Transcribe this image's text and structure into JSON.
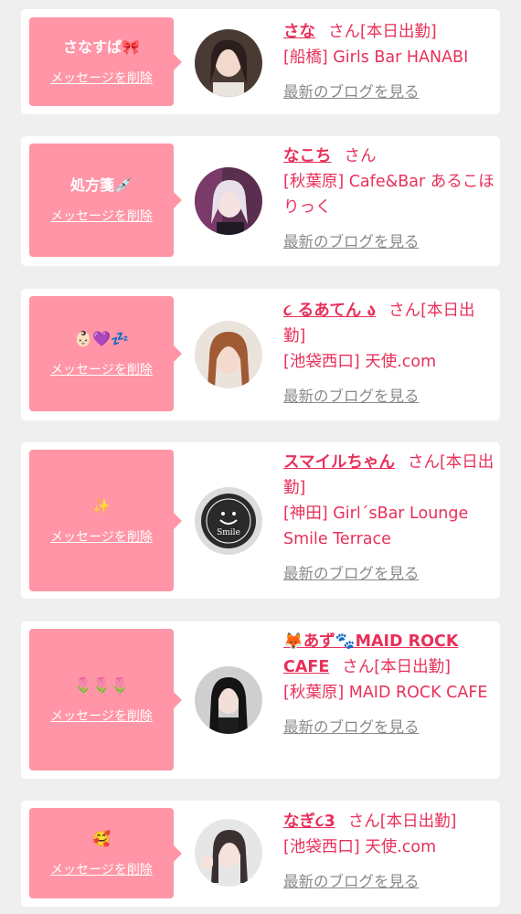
{
  "delete_label": "メッセージを削除",
  "blog_label": "最新のブログを見る",
  "san_label": "さん",
  "cards": [
    {
      "message": "さなすぱ🎀",
      "name": "さな",
      "san_suffix": "さん[本日出勤]",
      "shop": "[船橋] Girls Bar HANABI"
    },
    {
      "message": "処方箋💉",
      "name": "なこち",
      "san_suffix": "さん",
      "shop": "[秋葉原] Cafe&Bar あるこほりっく"
    },
    {
      "message": "👶🏻💜💤",
      "name": "૮ るあてん ა",
      "san_suffix": "さん[本日出勤]",
      "shop": "[池袋西口] 天使.com"
    },
    {
      "message": "✨",
      "name": "スマイルちゃん",
      "san_suffix": "さん[本日出勤]",
      "shop": "[神田] Girl´sBar Lounge Smile Terrace"
    },
    {
      "message": "🌷🌷🌷",
      "name": "🦊あず🐾MAID ROCK CAFE",
      "san_suffix": "さん[本日出勤]",
      "shop": "[秋葉原] MAID ROCK CAFE"
    },
    {
      "message": "🥰",
      "name": "なぎ૮3",
      "san_suffix": "さん[本日出勤]",
      "shop": "[池袋西口] 天使.com"
    }
  ],
  "colors": {
    "accent": "#e8305a",
    "bubble": "#ff95a6",
    "background": "#efefef",
    "muted": "#8a8a8a"
  }
}
